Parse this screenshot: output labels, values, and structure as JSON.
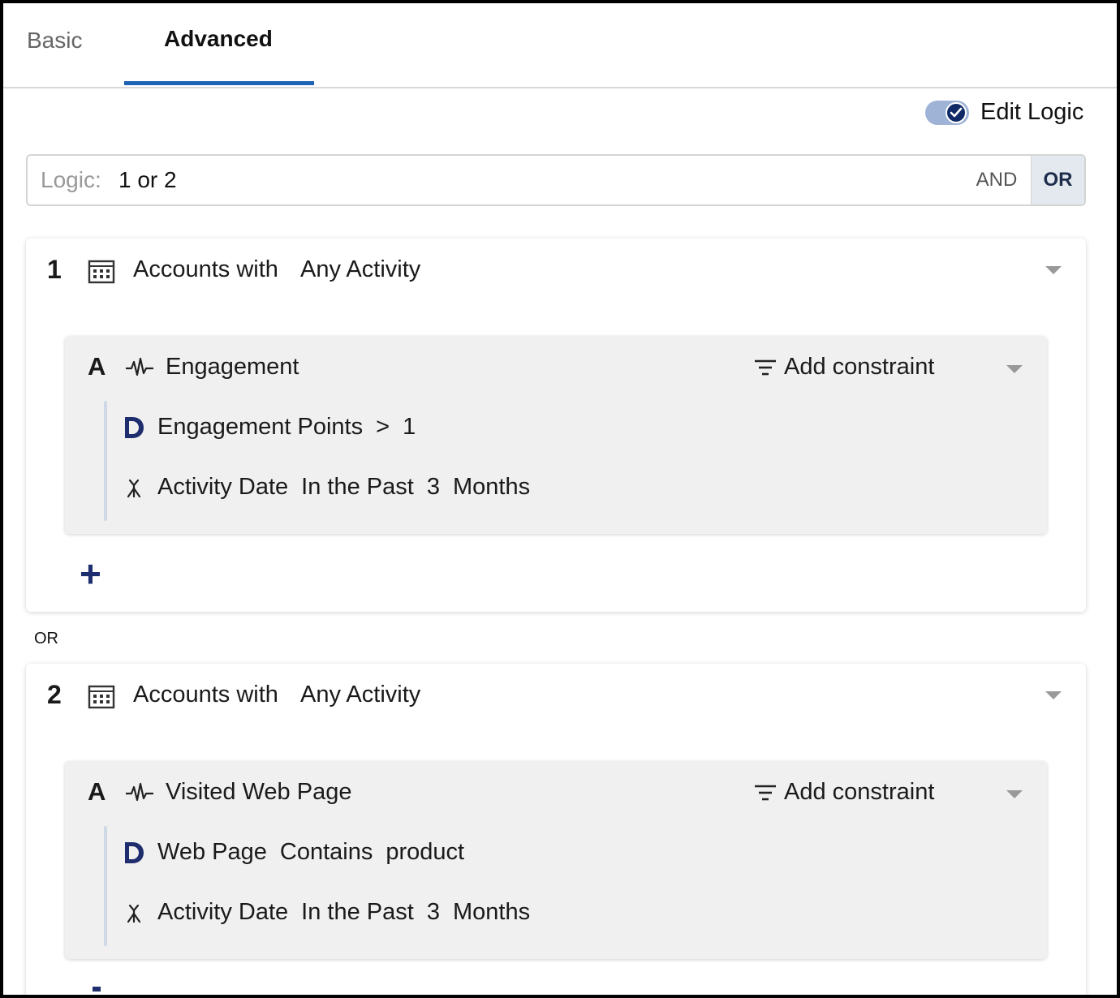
{
  "tabs": [
    {
      "label": "Basic",
      "active": false
    },
    {
      "label": "Advanced",
      "active": true
    }
  ],
  "edit_logic": {
    "label": "Edit Logic",
    "enabled": true
  },
  "logic": {
    "label": "Logic:",
    "value": "1 or 2",
    "operators": [
      "AND",
      "OR"
    ],
    "selected": "OR"
  },
  "groups": [
    {
      "number": "1",
      "icon": "building-icon",
      "prefix": "Accounts with",
      "activity": "Any Activity",
      "sub": {
        "letter": "A",
        "icon": "pulse-icon",
        "name": "Engagement",
        "add_constraint": "Add constraint",
        "constraints": [
          {
            "icon": "d-icon",
            "field": "Engagement Points",
            "op": ">",
            "value": "1"
          },
          {
            "icon": "branch-icon",
            "field": "Activity Date",
            "op": "In the Past",
            "value": "3",
            "unit": "Months"
          }
        ]
      }
    },
    {
      "number": "2",
      "icon": "building-icon",
      "prefix": "Accounts with",
      "activity": "Any Activity",
      "sub": {
        "letter": "A",
        "icon": "pulse-icon",
        "name": "Visited Web Page",
        "add_constraint": "Add constraint",
        "constraints": [
          {
            "icon": "d-icon",
            "field": "Web Page",
            "op": "Contains",
            "value": "product"
          },
          {
            "icon": "branch-icon",
            "field": "Activity Date",
            "op": "In the Past",
            "value": "3",
            "unit": "Months"
          }
        ]
      }
    }
  ],
  "separator": "OR",
  "colors": {
    "accent": "#1e64b4",
    "brand_dark": "#1e2d6e",
    "panel": "#f0f0f0"
  }
}
